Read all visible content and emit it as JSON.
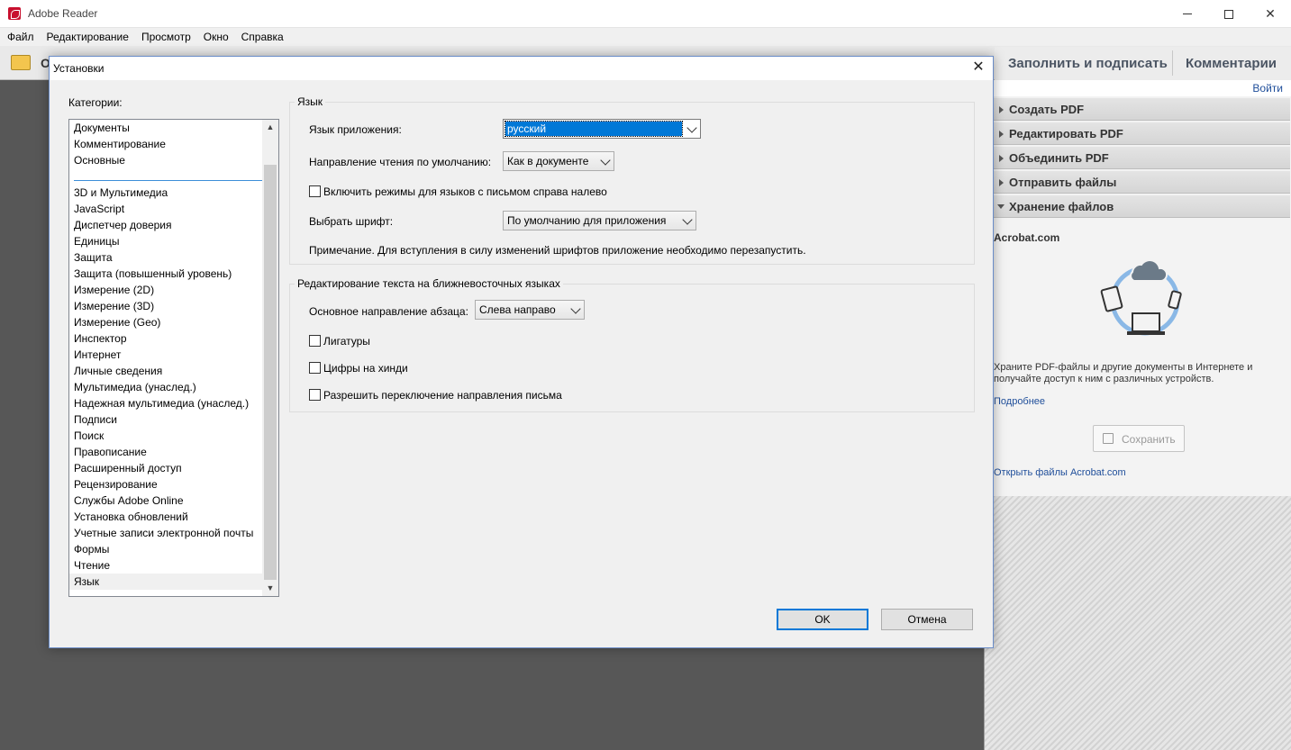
{
  "window": {
    "title": "Adobe Reader",
    "controls": [
      "minimize",
      "maximize",
      "close"
    ]
  },
  "menu": [
    "Файл",
    "Редактирование",
    "Просмотр",
    "Окно",
    "Справка"
  ],
  "toolbar": {
    "open_label": "О"
  },
  "right_header": {
    "fill_sign": "Заполнить и подписать",
    "comments": "Комментарии"
  },
  "right_pane": {
    "sign_in": "Войти",
    "panels": [
      {
        "label": "Создать PDF",
        "expanded": false
      },
      {
        "label": "Редактировать PDF",
        "expanded": false
      },
      {
        "label": "Объединить PDF",
        "expanded": false
      },
      {
        "label": "Отправить файлы",
        "expanded": false
      },
      {
        "label": "Хранение файлов",
        "expanded": true
      }
    ],
    "site": "Acrobat.com",
    "store_text": "Храните PDF-файлы и другие документы в Интернете и получайте доступ к ним с различных устройств.",
    "more": "Подробнее",
    "save": "Сохранить",
    "open_files": "Открыть файлы Acrobat.com"
  },
  "dialog": {
    "title": "Установки",
    "categories_label": "Категории:",
    "categories_top": [
      "Документы",
      "Комментирование",
      "Основные"
    ],
    "categories": [
      "3D и Мультимедиа",
      "JavaScript",
      "Диспетчер доверия",
      "Единицы",
      "Защита",
      "Защита (повышенный уровень)",
      "Измерение (2D)",
      "Измерение (3D)",
      "Измерение (Geo)",
      "Инспектор",
      "Интернет",
      "Личные сведения",
      "Мультимедиа (унаслед.)",
      "Надежная мультимедиа (унаслед.)",
      "Подписи",
      "Поиск",
      "Правописание",
      "Расширенный доступ",
      "Рецензирование",
      "Службы Adobe Online",
      "Установка обновлений",
      "Учетные записи электронной почты",
      "Формы",
      "Чтение",
      "Язык"
    ],
    "selected_category": "Язык",
    "language_group": {
      "title": "Язык",
      "app_lang_label": "Язык приложения:",
      "app_lang_value": "русский",
      "reading_dir_label": "Направление чтения по умолчанию:",
      "reading_dir_value": "Как в документе",
      "rtl_label": "Включить режимы для языков с письмом справа налево",
      "rtl_checked": false,
      "font_label": "Выбрать шрифт:",
      "font_value": "По умолчанию для приложения",
      "note": "Примечание. Для вступления в силу изменений шрифтов приложение необходимо перезапустить."
    },
    "mideast_group": {
      "title": "Редактирование текста на ближневосточных языках",
      "para_dir_label": "Основное направление абзаца:",
      "para_dir_value": "Слева направо",
      "ligatures_label": "Лигатуры",
      "ligatures_checked": false,
      "hindi_label": "Цифры на хинди",
      "hindi_checked": false,
      "dir_switch_label": "Разрешить переключение направления письма",
      "dir_switch_checked": false
    },
    "ok": "OK",
    "cancel": "Отмена"
  }
}
